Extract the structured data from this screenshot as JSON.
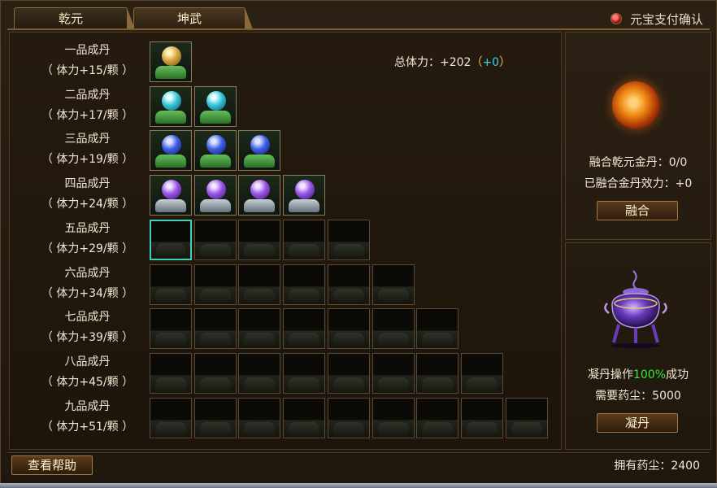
{
  "tabs": [
    {
      "label": "乾元",
      "active": false
    },
    {
      "label": "坤武",
      "active": true
    }
  ],
  "pay_confirm_label": "元宝支付确认",
  "total_power": {
    "label": "总体力：",
    "value": "+202",
    "open": "（",
    "bonus": "+0",
    "close": "）"
  },
  "rows": [
    {
      "name": "一品成丹",
      "stat": "（ 体力+15/颗 ）",
      "slots": 1,
      "filled": 1,
      "pill": "gold"
    },
    {
      "name": "二品成丹",
      "stat": "（ 体力+17/颗 ）",
      "slots": 2,
      "filled": 2,
      "pill": "cyan"
    },
    {
      "name": "三品成丹",
      "stat": "（ 体力+19/颗 ）",
      "slots": 3,
      "filled": 3,
      "pill": "blue"
    },
    {
      "name": "四品成丹",
      "stat": "（ 体力+24/颗 ）",
      "slots": 4,
      "filled": 4,
      "pill": "violet"
    },
    {
      "name": "五品成丹",
      "stat": "（ 体力+29/颗 ）",
      "slots": 5,
      "filled": 0,
      "pill": ""
    },
    {
      "name": "六品成丹",
      "stat": "（ 体力+34/颗 ）",
      "slots": 6,
      "filled": 0,
      "pill": ""
    },
    {
      "name": "七品成丹",
      "stat": "（ 体力+39/颗 ）",
      "slots": 7,
      "filled": 0,
      "pill": ""
    },
    {
      "name": "八品成丹",
      "stat": "（ 体力+45/颗 ）",
      "slots": 8,
      "filled": 0,
      "pill": ""
    },
    {
      "name": "九品成丹",
      "stat": "（ 体力+51/颗 ）",
      "slots": 9,
      "filled": 0,
      "pill": ""
    }
  ],
  "fusion": {
    "count_label": "融合乾元金丹：0/0",
    "effect_label": "已融合金丹效力：+0",
    "button": "融合"
  },
  "condense": {
    "op_prefix": "凝丹操作",
    "op_rate": "100%",
    "op_suffix": "成功",
    "cost_label": "需要药尘：5000",
    "button": "凝丹"
  },
  "help_button": "查看帮助",
  "owned_dust": "拥有药尘：2400",
  "icons": {
    "orb": "golden-elixir-orb-icon",
    "cauldron": "alchemy-cauldron-icon"
  },
  "colors": {
    "accent_green": "#36e836",
    "bonus_cyan": "#33d6ee",
    "selected_border": "#3fd0b8"
  }
}
